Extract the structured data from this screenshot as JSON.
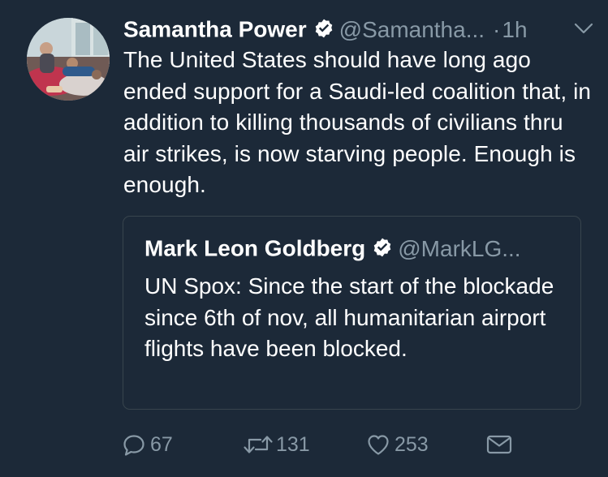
{
  "tweet": {
    "display_name": "Samantha Power",
    "handle": "@Samantha...",
    "separator": "·",
    "timestamp": "1h",
    "text": "The United States should have long ago ended support for a Saudi-led coalition that, in addition to killing thousands of civilians thru air strikes, is now starving people. Enough is enough."
  },
  "quoted_tweet": {
    "display_name": "Mark Leon Goldberg",
    "handle": "@MarkLG...",
    "text": "UN Spox: Since the start of the blockade since 6th of nov, all humanitarian airport flights have been blocked."
  },
  "actions": {
    "reply_count": "67",
    "retweet_count": "131",
    "like_count": "253"
  },
  "icons": {
    "verified": "verified-badge-icon",
    "caret": "chevron-down-icon",
    "reply": "reply-icon",
    "retweet": "retweet-icon",
    "like": "heart-icon",
    "dm": "envelope-icon"
  },
  "colors": {
    "background": "#1c2938",
    "text": "#ffffff",
    "secondary_text": "#8899a6",
    "border": "#38444d",
    "verified_badge": "#ffffff"
  }
}
